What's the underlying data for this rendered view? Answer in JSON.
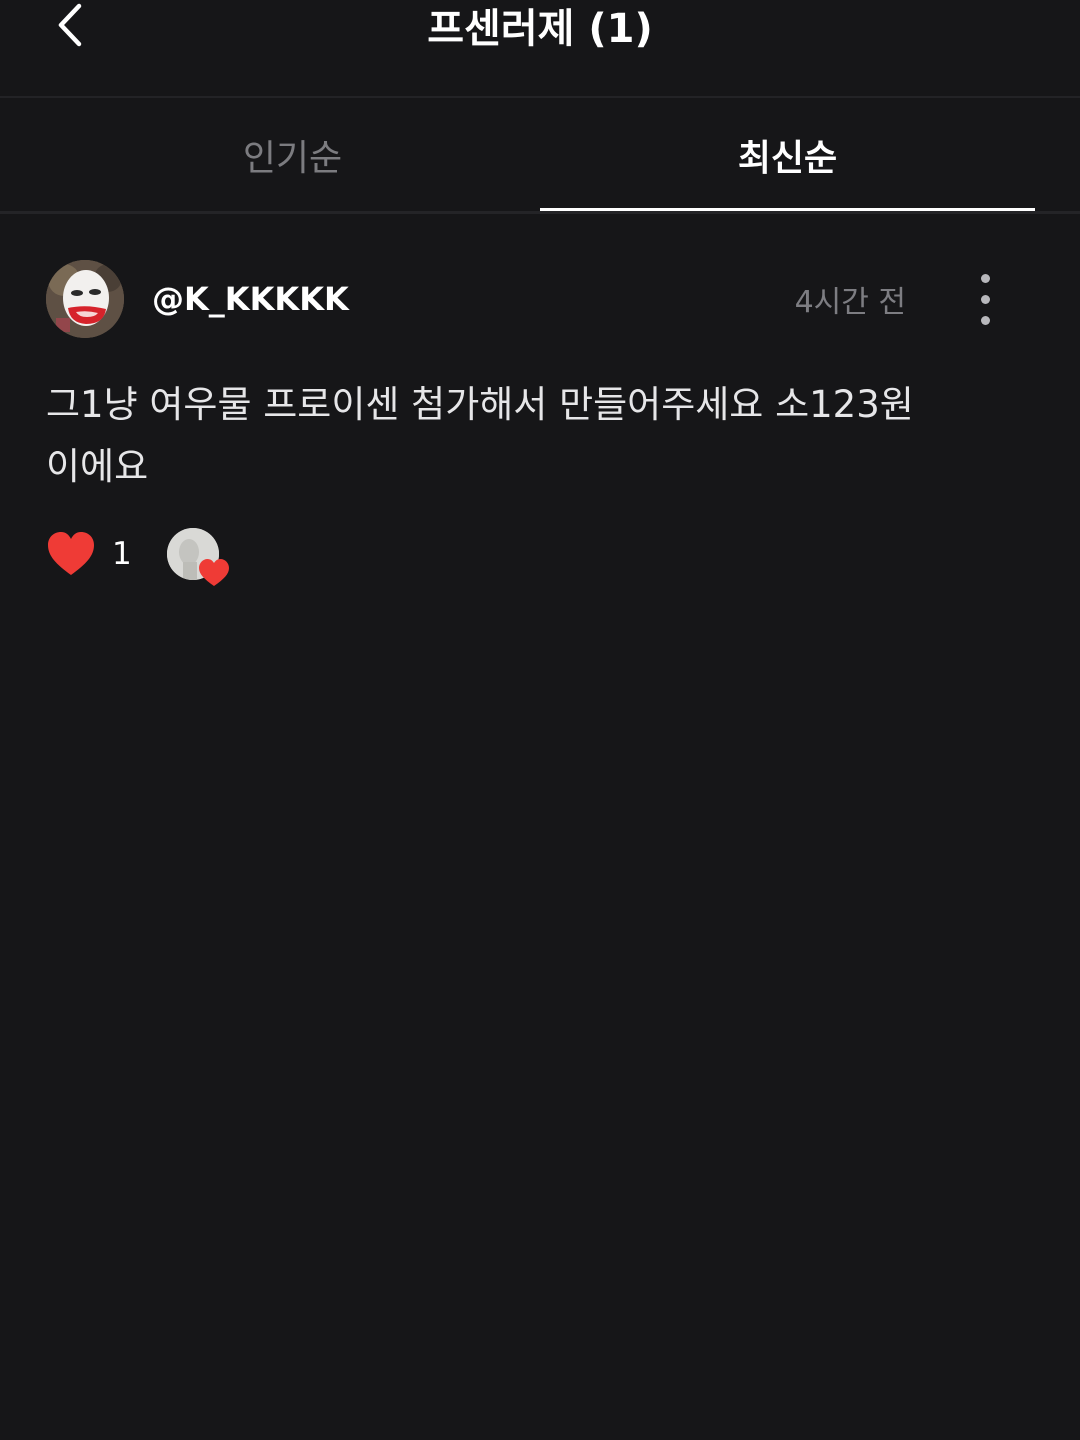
{
  "header": {
    "title": "프센러제 (1)",
    "back_icon": "chevron-left-icon"
  },
  "tabs": [
    {
      "label": "인기순",
      "active": false
    },
    {
      "label": "최신순",
      "active": true
    }
  ],
  "comment": {
    "username": "@K_KKKKK",
    "timestamp": "4시간 전",
    "text": "그1냥 여우물 프로이센 첨가해서 만들어주세요 소123원 이에요",
    "like_count": "1",
    "liked": true,
    "more_icon": "more-vertical-icon"
  },
  "colors": {
    "background": "#161618",
    "accent_heart": "#ef3b36",
    "muted_text": "#7c7c80"
  }
}
